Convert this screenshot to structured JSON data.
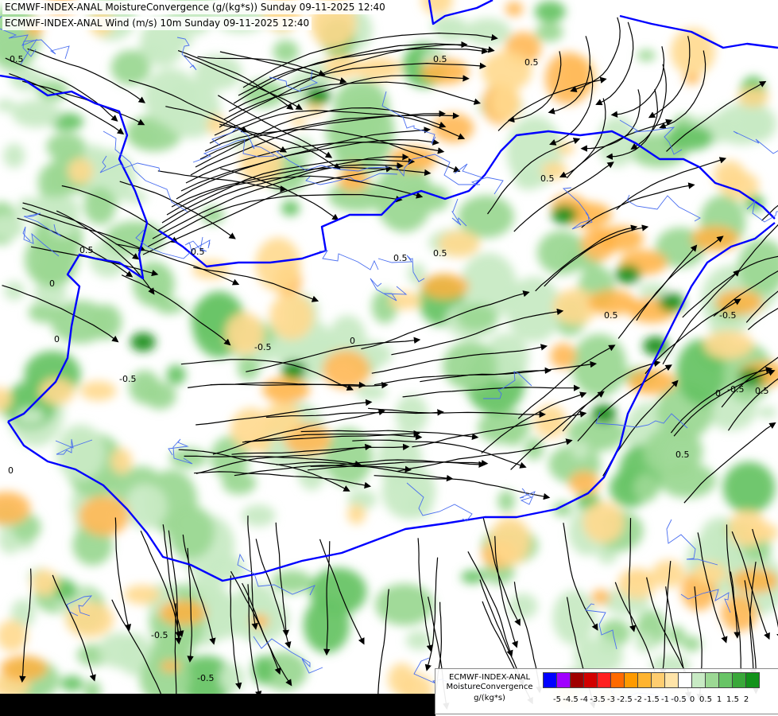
{
  "titles": {
    "line1": "ECMWF-INDEX-ANAL MoistureConvergence (g/(kg*s)) Sunday 09-11-2025 12:40",
    "line2": "ECMWF-INDEX-ANAL Wind (m/s) 10m Sunday 09-11-2025 12:40"
  },
  "legend": {
    "line1": "ECMWF-INDEX-ANAL",
    "line2": "MoistureConvergence",
    "line3": "g/(kg*s)",
    "colors": [
      "#0000ff",
      "#a000ff",
      "#a00000",
      "#d20000",
      "#ff2020",
      "#ff6a00",
      "#ff9a00",
      "#ffb430",
      "#ffcd70",
      "#ffe4a8",
      "#ffffff",
      "#c8eac4",
      "#9cd894",
      "#68c466",
      "#3aa83a",
      "#12921a"
    ],
    "ticks": [
      "-5",
      "-4.5",
      "-4",
      "-3.5",
      "-3",
      "-2.5",
      "-2",
      "-1.5",
      "-1",
      "-0.5",
      "0",
      "0.5",
      "1",
      "1.5",
      "2"
    ]
  },
  "contour_labels": [
    "0.5",
    "0.5",
    "0.5",
    "0.5",
    "0.5",
    "0",
    "0",
    "0",
    "0",
    "-0.5",
    "-0.5",
    "-0.5",
    "-0.5",
    "-0.5",
    "0.5",
    "0.5",
    "0.5",
    "0",
    "0.5",
    "-0.5",
    "0.5",
    "0.5"
  ],
  "colors": {
    "water": "#0000ff",
    "rivers": "#4a6ef0",
    "streamline": "#000000",
    "land": "#ffffff"
  }
}
